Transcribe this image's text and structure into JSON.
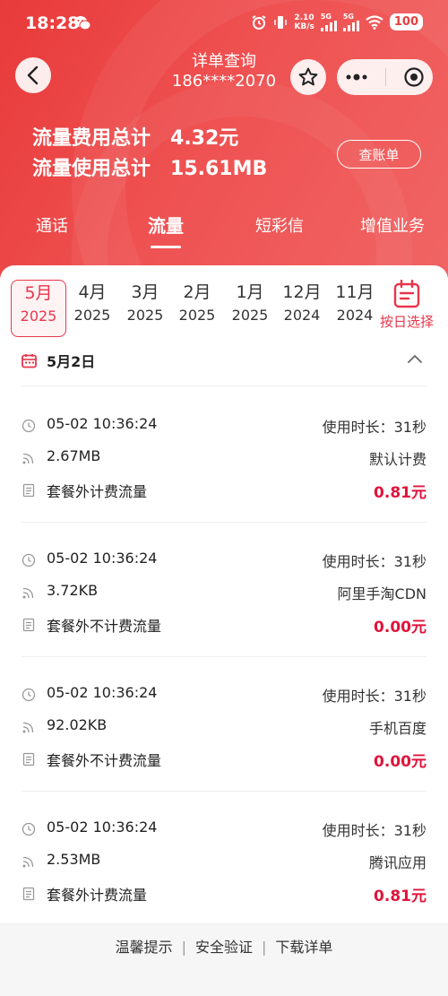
{
  "status_bar": {
    "time": "18:28",
    "net_speed_top": "2.10",
    "net_speed_unit": "KB/s",
    "sig1": "5G",
    "sig2": "5G",
    "battery": "100"
  },
  "nav": {
    "title": "详单查询",
    "phone": "186****2070"
  },
  "summary": {
    "fee_label": "流量费用总计",
    "fee_value": "4.32元",
    "usage_label": "流量使用总计",
    "usage_value": "15.61MB",
    "bill_button": "查账单"
  },
  "tabs": [
    {
      "label": "通话"
    },
    {
      "label": "流量"
    },
    {
      "label": "短彩信"
    },
    {
      "label": "增值业务"
    }
  ],
  "months": [
    {
      "m": "5月",
      "y": "2025"
    },
    {
      "m": "4月",
      "y": "2025"
    },
    {
      "m": "3月",
      "y": "2025"
    },
    {
      "m": "2月",
      "y": "2025"
    },
    {
      "m": "1月",
      "y": "2025"
    },
    {
      "m": "12月",
      "y": "2024"
    },
    {
      "m": "11月",
      "y": "2024"
    }
  ],
  "pick_day_label": "按日选择",
  "day_header": "5月2日",
  "records": [
    {
      "time": "05-02 10:36:24",
      "duration": "使用时长：31秒",
      "size": "2.67MB",
      "app": "默认计费",
      "type": "套餐外计费流量",
      "fee": "0.81元"
    },
    {
      "time": "05-02 10:36:24",
      "duration": "使用时长：31秒",
      "size": "3.72KB",
      "app": "阿里手淘CDN",
      "type": "套餐外不计费流量",
      "fee": "0.00元"
    },
    {
      "time": "05-02 10:36:24",
      "duration": "使用时长：31秒",
      "size": "92.02KB",
      "app": "手机百度",
      "type": "套餐外不计费流量",
      "fee": "0.00元"
    },
    {
      "time": "05-02 10:36:24",
      "duration": "使用时长：31秒",
      "size": "2.53MB",
      "app": "腾讯应用",
      "type": "套餐外计费流量",
      "fee": "0.81元"
    }
  ],
  "footer": {
    "link1": "温馨提示",
    "link2": "安全验证",
    "link3": "下载详单"
  },
  "colors": {
    "brand_red": "#e8364b",
    "fee_red": "#e0143c"
  }
}
